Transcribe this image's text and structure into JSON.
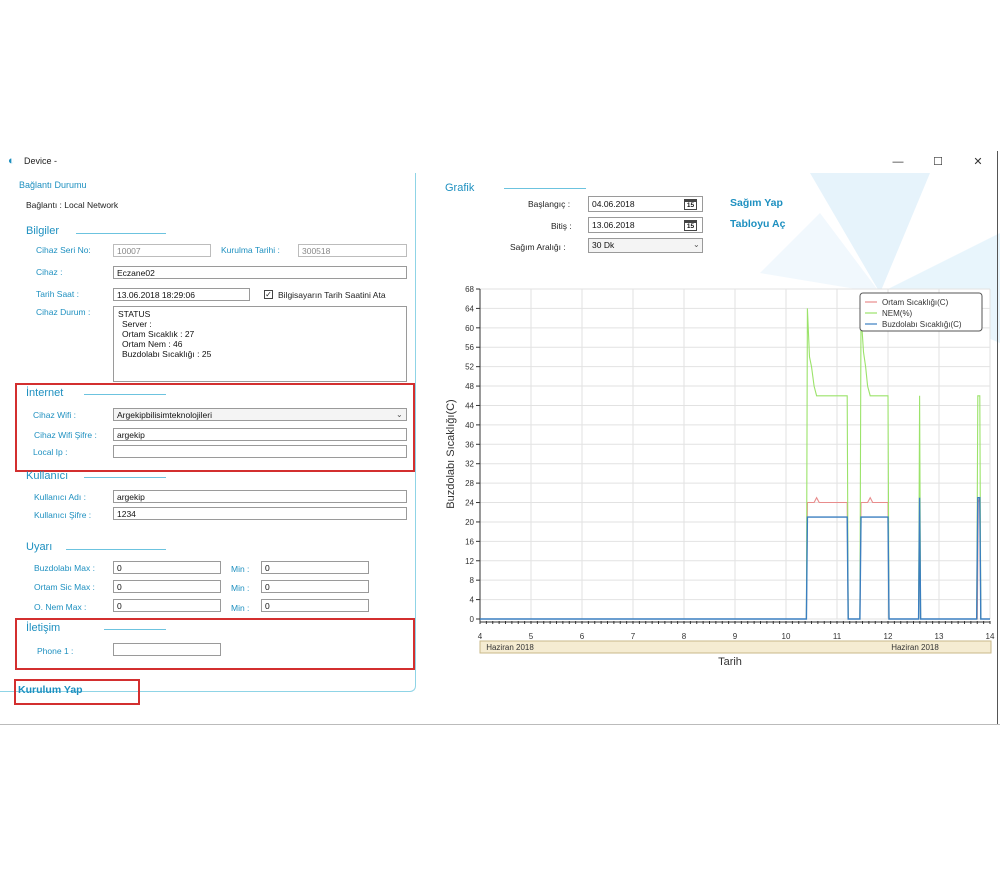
{
  "window": {
    "title": "Device -",
    "buttons": {
      "minimize": "—",
      "maximize": "☐",
      "close": "✕"
    }
  },
  "connection": {
    "section_title": "Bağlantı Durumu",
    "status_text": "Bağlantı : Local Network"
  },
  "info": {
    "section_title": "Bilgiler",
    "serial_label": "Cihaz Seri No:",
    "serial_value": "10007",
    "install_date_label": "Kurulma Tarihi :",
    "install_date_value": "300518",
    "device_label": "Cihaz :",
    "device_value": "Eczane02",
    "datetime_label": "Tarih Saat :",
    "datetime_value": "13.06.2018 18:29:06",
    "sync_checkbox_label": "Bilgisayarın Tarih Saatini Ata",
    "sync_checkbox_checked": true,
    "status_label": "Cihaz Durum :",
    "status_lines": [
      "STATUS",
      "Server :",
      "Ortam Sıcaklık : 27",
      "Ortam Nem : 46",
      "Buzdolabı Sıcaklığı : 25"
    ]
  },
  "internet": {
    "section_title": "İnternet",
    "wifi_label": "Cihaz Wifi :",
    "wifi_value": "Argekipbilisimteknolojileri",
    "wifi_password_label": "Cihaz Wifi Şifre :",
    "wifi_password_value": "argekip",
    "local_ip_label": "Local Ip :",
    "local_ip_value": ""
  },
  "user": {
    "section_title": "Kullanıcı",
    "username_label": "Kullanıcı Adı :",
    "username_value": "argekip",
    "password_label": "Kullanıcı Şifre :",
    "password_value": "1234"
  },
  "alerts": {
    "section_title": "Uyarı",
    "min_label": "Min :",
    "rows": [
      {
        "label": "Buzdolabı Max :",
        "max": "0",
        "min": "0"
      },
      {
        "label": "Ortam Sic Max :",
        "max": "0",
        "min": "0"
      },
      {
        "label": "O. Nem Max :",
        "max": "0",
        "min": "0"
      }
    ]
  },
  "contact": {
    "section_title": "İletişim",
    "phone_label": "Phone 1 :",
    "phone_value": ""
  },
  "install_button": "Kurulum Yap",
  "graph": {
    "section_title": "Grafik",
    "start_label": "Başlangıç :",
    "start_value": "04.06.2018",
    "end_label": "Bitiş :",
    "end_value": "13.06.2018",
    "interval_label": "Sağım Aralığı :",
    "interval_value": "30 Dk",
    "calendar_icon_text": "15",
    "action_sample": "Sağım Yap",
    "action_table": "Tabloyu Aç"
  },
  "colors": {
    "accent": "#1e90c0",
    "red_highlight": "#d32f2f",
    "ortam": "#e88c8c",
    "nem": "#9be36a",
    "buzdolabi": "#3a7fc0"
  },
  "chart_data": {
    "type": "line",
    "ylabel": "Buzdolabı Sıcaklığı(C)",
    "xlabel": "Tarih",
    "ylim": [
      0,
      68
    ],
    "xlim": [
      4,
      14
    ],
    "yticks": [
      0,
      4,
      8,
      12,
      16,
      20,
      24,
      28,
      32,
      36,
      40,
      44,
      48,
      52,
      56,
      60,
      64,
      68
    ],
    "xticks": [
      4,
      5,
      6,
      7,
      8,
      9,
      10,
      11,
      12,
      13,
      14
    ],
    "month_labels": [
      "Haziran 2018",
      "Haziran 2018"
    ],
    "grid": true,
    "legend": "top-right",
    "series": [
      {
        "name": "Ortam Sıcaklığı(C)",
        "color_key": "ortam",
        "points": [
          [
            10.4,
            0
          ],
          [
            10.42,
            24
          ],
          [
            10.55,
            24
          ],
          [
            10.6,
            25
          ],
          [
            10.65,
            24
          ],
          [
            11.2,
            24
          ],
          [
            11.22,
            0
          ],
          [
            11.45,
            0
          ],
          [
            11.47,
            24
          ],
          [
            11.6,
            24
          ],
          [
            11.65,
            25
          ],
          [
            11.7,
            24
          ],
          [
            12.0,
            24
          ],
          [
            12.02,
            0
          ],
          [
            12.6,
            0
          ],
          [
            12.62,
            24
          ],
          [
            12.64,
            0
          ],
          [
            13.75,
            0
          ],
          [
            13.77,
            24
          ],
          [
            13.8,
            25
          ],
          [
            13.82,
            0
          ],
          [
            14.0,
            0
          ]
        ]
      },
      {
        "name": "NEM(%)",
        "color_key": "nem",
        "points": [
          [
            10.4,
            0
          ],
          [
            10.42,
            64
          ],
          [
            10.46,
            54
          ],
          [
            10.5,
            52
          ],
          [
            10.55,
            48
          ],
          [
            10.6,
            46
          ],
          [
            11.2,
            46
          ],
          [
            11.22,
            0
          ],
          [
            11.45,
            0
          ],
          [
            11.47,
            63
          ],
          [
            11.52,
            55
          ],
          [
            11.56,
            52
          ],
          [
            11.6,
            48
          ],
          [
            11.65,
            46
          ],
          [
            12.0,
            46
          ],
          [
            12.02,
            0
          ],
          [
            12.6,
            0
          ],
          [
            12.62,
            46
          ],
          [
            12.64,
            0
          ],
          [
            13.74,
            0
          ],
          [
            13.76,
            46
          ],
          [
            13.8,
            46
          ],
          [
            13.82,
            0
          ],
          [
            14.0,
            0
          ]
        ]
      },
      {
        "name": "Buzdolabı Sıcaklığı(C)",
        "color_key": "buzdolabi",
        "points": [
          [
            4.0,
            0
          ],
          [
            10.4,
            0
          ],
          [
            10.42,
            21
          ],
          [
            11.2,
            21
          ],
          [
            11.22,
            0
          ],
          [
            11.45,
            0
          ],
          [
            11.47,
            21
          ],
          [
            12.0,
            21
          ],
          [
            12.02,
            0
          ],
          [
            12.6,
            0
          ],
          [
            12.62,
            25
          ],
          [
            12.64,
            0
          ],
          [
            13.74,
            0
          ],
          [
            13.76,
            25
          ],
          [
            13.8,
            25
          ],
          [
            13.82,
            0
          ],
          [
            14.0,
            0
          ]
        ]
      }
    ]
  }
}
